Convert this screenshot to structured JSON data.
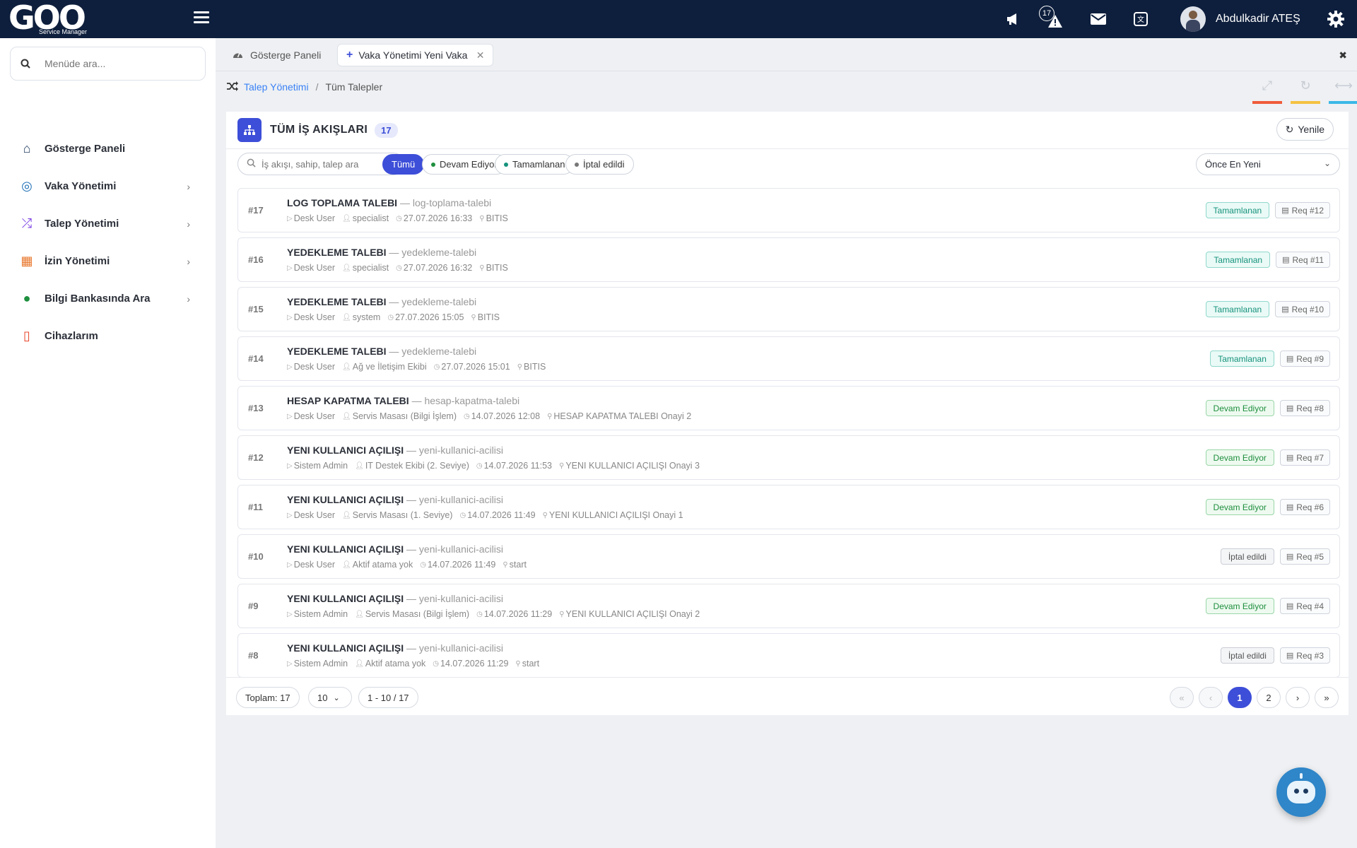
{
  "app": {
    "logo_text": "GOO",
    "logo_sub": "Service Manager",
    "notifications_count": "17",
    "user_name": "Abdulkadir ATEŞ"
  },
  "sidebar": {
    "search_placeholder": "Menüde ara...",
    "items": [
      {
        "label": "Gösterge Paneli",
        "icon": "home-icon",
        "color": "#1e3a5f",
        "glyph": "⌂",
        "has_chevron": false
      },
      {
        "label": "Vaka Yönetimi",
        "icon": "lifebuoy-icon",
        "color": "#1f6fb5",
        "glyph": "◎",
        "has_chevron": true
      },
      {
        "label": "Talep Yönetimi",
        "icon": "shuffle-icon",
        "color": "#7b3fe4",
        "glyph": "⤮",
        "has_chevron": true
      },
      {
        "label": "İzin Yönetimi",
        "icon": "calendar-icon",
        "color": "#e8752a",
        "glyph": "▦",
        "has_chevron": true
      },
      {
        "label": "Bilgi Bankasında Ara",
        "icon": "google-icon",
        "color": "#1e8f3e",
        "glyph": "●",
        "has_chevron": true
      },
      {
        "label": "Cihazlarım",
        "icon": "mobile-icon",
        "color": "#e8452a",
        "glyph": "▯",
        "has_chevron": false
      }
    ]
  },
  "tabs": [
    {
      "label": "Gösterge Paneli"
    },
    {
      "label": "Vaka Yönetimi Yeni Vaka"
    }
  ],
  "breadcrumb": {
    "parent": "Talep Yönetimi",
    "current": "Tüm Talepler"
  },
  "panel": {
    "title": "TÜM İŞ AKIŞLARI",
    "count": "17",
    "refresh_label": "Yenile",
    "search_placeholder": "İş akışı, sahip, talep ara",
    "filters": [
      {
        "label": "Tümü",
        "active": true,
        "dot": ""
      },
      {
        "label": "Devam Ediyor",
        "active": false,
        "dot": "#1f8f3e"
      },
      {
        "label": "Tamamlanan",
        "active": false,
        "dot": "#15927c"
      },
      {
        "label": "İptal edildi",
        "active": false,
        "dot": "#777777"
      }
    ],
    "sort_value": "Önce En Yeni"
  },
  "workflows": [
    {
      "id": "#17",
      "name": "LOG TOPLAMA TALEBI",
      "slug": "— log-toplama-talebi",
      "user": "Desk User",
      "owner": "specialist",
      "date": "27.07.2026 16:33",
      "step": "BITIS",
      "status": "Tamamlanan",
      "status_type": "done",
      "req": "Req #12"
    },
    {
      "id": "#16",
      "name": "YEDEKLEME TALEBI",
      "slug": "— yedekleme-talebi",
      "user": "Desk User",
      "owner": "specialist",
      "date": "27.07.2026 16:32",
      "step": "BITIS",
      "status": "Tamamlanan",
      "status_type": "done",
      "req": "Req #11"
    },
    {
      "id": "#15",
      "name": "YEDEKLEME TALEBI",
      "slug": "— yedekleme-talebi",
      "user": "Desk User",
      "owner": "system",
      "date": "27.07.2026 15:05",
      "step": "BITIS",
      "status": "Tamamlanan",
      "status_type": "done",
      "req": "Req #10"
    },
    {
      "id": "#14",
      "name": "YEDEKLEME TALEBI",
      "slug": "— yedekleme-talebi",
      "user": "Desk User",
      "owner": "Ağ ve İletişim Ekibi",
      "date": "27.07.2026 15:01",
      "step": "BITIS",
      "status": "Tamamlanan",
      "status_type": "done",
      "req": "Req #9"
    },
    {
      "id": "#13",
      "name": "HESAP KAPATMA TALEBI",
      "slug": "— hesap-kapatma-talebi",
      "user": "Desk User",
      "owner": "Servis Masası (Bilgi İşlem)",
      "date": "14.07.2026 12:08",
      "step": "HESAP KAPATMA TALEBI Onayi 2",
      "status": "Devam Ediyor",
      "status_type": "prog",
      "req": "Req #8"
    },
    {
      "id": "#12",
      "name": "YENI KULLANICI AÇILIŞI",
      "slug": "— yeni-kullanici-acilisi",
      "user": "Sistem Admin",
      "owner": "IT Destek Ekibi (2. Seviye)",
      "date": "14.07.2026 11:53",
      "step": "YENI KULLANICI AÇILIŞI Onayi 3",
      "status": "Devam Ediyor",
      "status_type": "prog",
      "req": "Req #7"
    },
    {
      "id": "#11",
      "name": "YENI KULLANICI AÇILIŞI",
      "slug": "— yeni-kullanici-acilisi",
      "user": "Desk User",
      "owner": "Servis Masası (1. Seviye)",
      "date": "14.07.2026 11:49",
      "step": "YENI KULLANICI AÇILIŞI Onayi 1",
      "status": "Devam Ediyor",
      "status_type": "prog",
      "req": "Req #6"
    },
    {
      "id": "#10",
      "name": "YENI KULLANICI AÇILIŞI",
      "slug": "— yeni-kullanici-acilisi",
      "user": "Desk User",
      "owner": "Aktif atama yok",
      "date": "14.07.2026 11:49",
      "step": "start",
      "status": "İptal edildi",
      "status_type": "canc",
      "req": "Req #5"
    },
    {
      "id": "#9",
      "name": "YENI KULLANICI AÇILIŞI",
      "slug": "— yeni-kullanici-acilisi",
      "user": "Sistem Admin",
      "owner": "Servis Masası (Bilgi İşlem)",
      "date": "14.07.2026 11:29",
      "step": "YENI KULLANICI AÇILIŞI Onayi 2",
      "status": "Devam Ediyor",
      "status_type": "prog",
      "req": "Req #4"
    },
    {
      "id": "#8",
      "name": "YENI KULLANICI AÇILIŞI",
      "slug": "— yeni-kullanici-acilisi",
      "user": "Sistem Admin",
      "owner": "Aktif atama yok",
      "date": "14.07.2026 11:29",
      "step": "start",
      "status": "İptal edildi",
      "status_type": "canc",
      "req": "Req #3"
    }
  ],
  "footer": {
    "total": "Toplam: 17",
    "page_size": "10",
    "range": "1 - 10 / 17",
    "pages": [
      "«",
      "‹",
      "1",
      "2",
      "›",
      "»"
    ]
  }
}
